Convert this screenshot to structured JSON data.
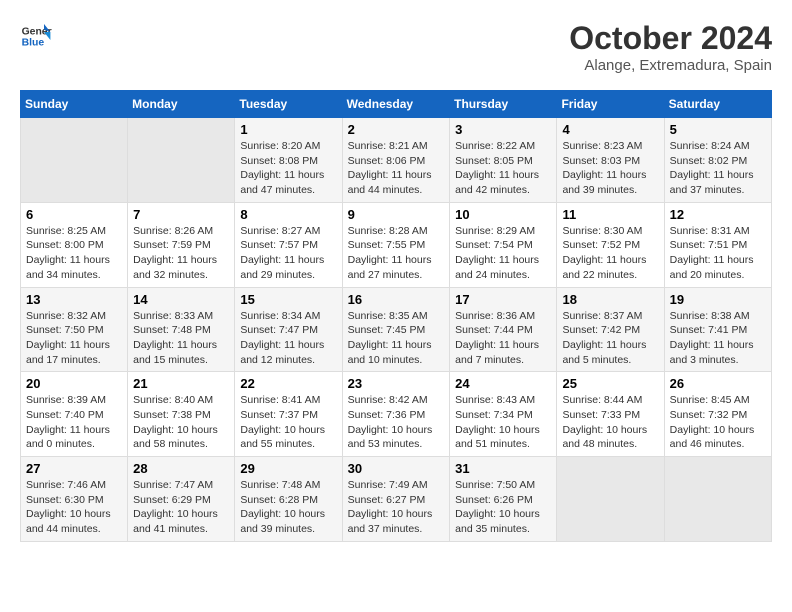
{
  "header": {
    "logo_line1": "General",
    "logo_line2": "Blue",
    "month_title": "October 2024",
    "subtitle": "Alange, Extremadura, Spain"
  },
  "weekdays": [
    "Sunday",
    "Monday",
    "Tuesday",
    "Wednesday",
    "Thursday",
    "Friday",
    "Saturday"
  ],
  "weeks": [
    [
      {
        "day": "",
        "empty": true
      },
      {
        "day": "",
        "empty": true
      },
      {
        "day": "1",
        "sunrise": "8:20 AM",
        "sunset": "8:08 PM",
        "daylight": "11 hours and 47 minutes."
      },
      {
        "day": "2",
        "sunrise": "8:21 AM",
        "sunset": "8:06 PM",
        "daylight": "11 hours and 44 minutes."
      },
      {
        "day": "3",
        "sunrise": "8:22 AM",
        "sunset": "8:05 PM",
        "daylight": "11 hours and 42 minutes."
      },
      {
        "day": "4",
        "sunrise": "8:23 AM",
        "sunset": "8:03 PM",
        "daylight": "11 hours and 39 minutes."
      },
      {
        "day": "5",
        "sunrise": "8:24 AM",
        "sunset": "8:02 PM",
        "daylight": "11 hours and 37 minutes."
      }
    ],
    [
      {
        "day": "6",
        "sunrise": "8:25 AM",
        "sunset": "8:00 PM",
        "daylight": "11 hours and 34 minutes."
      },
      {
        "day": "7",
        "sunrise": "8:26 AM",
        "sunset": "7:59 PM",
        "daylight": "11 hours and 32 minutes."
      },
      {
        "day": "8",
        "sunrise": "8:27 AM",
        "sunset": "7:57 PM",
        "daylight": "11 hours and 29 minutes."
      },
      {
        "day": "9",
        "sunrise": "8:28 AM",
        "sunset": "7:55 PM",
        "daylight": "11 hours and 27 minutes."
      },
      {
        "day": "10",
        "sunrise": "8:29 AM",
        "sunset": "7:54 PM",
        "daylight": "11 hours and 24 minutes."
      },
      {
        "day": "11",
        "sunrise": "8:30 AM",
        "sunset": "7:52 PM",
        "daylight": "11 hours and 22 minutes."
      },
      {
        "day": "12",
        "sunrise": "8:31 AM",
        "sunset": "7:51 PM",
        "daylight": "11 hours and 20 minutes."
      }
    ],
    [
      {
        "day": "13",
        "sunrise": "8:32 AM",
        "sunset": "7:50 PM",
        "daylight": "11 hours and 17 minutes."
      },
      {
        "day": "14",
        "sunrise": "8:33 AM",
        "sunset": "7:48 PM",
        "daylight": "11 hours and 15 minutes."
      },
      {
        "day": "15",
        "sunrise": "8:34 AM",
        "sunset": "7:47 PM",
        "daylight": "11 hours and 12 minutes."
      },
      {
        "day": "16",
        "sunrise": "8:35 AM",
        "sunset": "7:45 PM",
        "daylight": "11 hours and 10 minutes."
      },
      {
        "day": "17",
        "sunrise": "8:36 AM",
        "sunset": "7:44 PM",
        "daylight": "11 hours and 7 minutes."
      },
      {
        "day": "18",
        "sunrise": "8:37 AM",
        "sunset": "7:42 PM",
        "daylight": "11 hours and 5 minutes."
      },
      {
        "day": "19",
        "sunrise": "8:38 AM",
        "sunset": "7:41 PM",
        "daylight": "11 hours and 3 minutes."
      }
    ],
    [
      {
        "day": "20",
        "sunrise": "8:39 AM",
        "sunset": "7:40 PM",
        "daylight": "11 hours and 0 minutes."
      },
      {
        "day": "21",
        "sunrise": "8:40 AM",
        "sunset": "7:38 PM",
        "daylight": "10 hours and 58 minutes."
      },
      {
        "day": "22",
        "sunrise": "8:41 AM",
        "sunset": "7:37 PM",
        "daylight": "10 hours and 55 minutes."
      },
      {
        "day": "23",
        "sunrise": "8:42 AM",
        "sunset": "7:36 PM",
        "daylight": "10 hours and 53 minutes."
      },
      {
        "day": "24",
        "sunrise": "8:43 AM",
        "sunset": "7:34 PM",
        "daylight": "10 hours and 51 minutes."
      },
      {
        "day": "25",
        "sunrise": "8:44 AM",
        "sunset": "7:33 PM",
        "daylight": "10 hours and 48 minutes."
      },
      {
        "day": "26",
        "sunrise": "8:45 AM",
        "sunset": "7:32 PM",
        "daylight": "10 hours and 46 minutes."
      }
    ],
    [
      {
        "day": "27",
        "sunrise": "7:46 AM",
        "sunset": "6:30 PM",
        "daylight": "10 hours and 44 minutes."
      },
      {
        "day": "28",
        "sunrise": "7:47 AM",
        "sunset": "6:29 PM",
        "daylight": "10 hours and 41 minutes."
      },
      {
        "day": "29",
        "sunrise": "7:48 AM",
        "sunset": "6:28 PM",
        "daylight": "10 hours and 39 minutes."
      },
      {
        "day": "30",
        "sunrise": "7:49 AM",
        "sunset": "6:27 PM",
        "daylight": "10 hours and 37 minutes."
      },
      {
        "day": "31",
        "sunrise": "7:50 AM",
        "sunset": "6:26 PM",
        "daylight": "10 hours and 35 minutes."
      },
      {
        "day": "",
        "empty": true
      },
      {
        "day": "",
        "empty": true
      }
    ]
  ]
}
